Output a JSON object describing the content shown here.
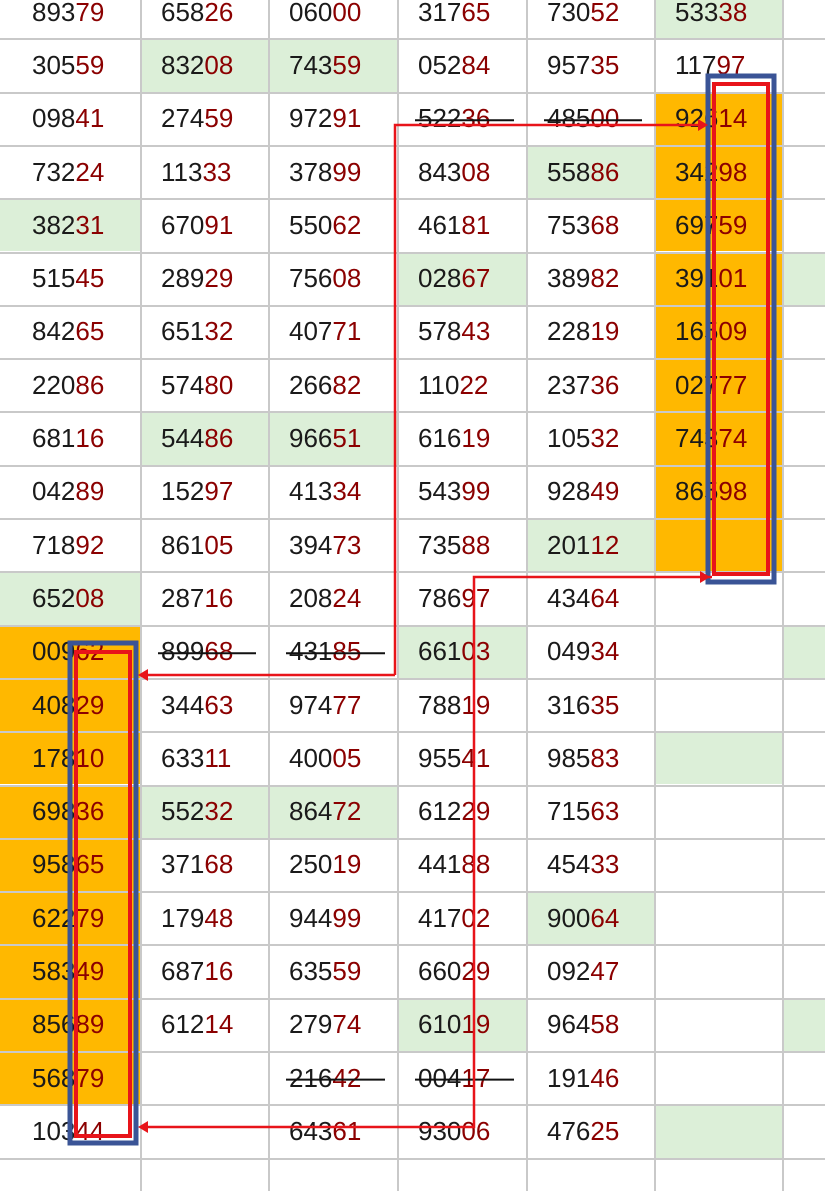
{
  "colors": {
    "highlight_green": "#dcefd8",
    "highlight_orange": "#ffb800",
    "digits_dark": "#1a1a1a",
    "digits_red": "#8b0000",
    "arrow_red": "#e8141a",
    "frame_blue": "#3a5496",
    "gridline": "#c9c9c9"
  },
  "rows": [
    [
      "89379",
      "65826",
      "06000",
      "31765",
      "73052",
      "53338",
      ""
    ],
    [
      "30559",
      "83208",
      "74359",
      "05284",
      "95735",
      "11797",
      ""
    ],
    [
      "09841",
      "27459",
      "97291",
      "52236",
      "48500",
      "92614",
      ""
    ],
    [
      "73224",
      "11333",
      "37899",
      "84308",
      "55886",
      "34298",
      ""
    ],
    [
      "38231",
      "67091",
      "55062",
      "46181",
      "75368",
      "69759",
      ""
    ],
    [
      "51545",
      "28929",
      "75608",
      "02867",
      "38982",
      "39101",
      ""
    ],
    [
      "84265",
      "65132",
      "40771",
      "57843",
      "22819",
      "16509",
      ""
    ],
    [
      "22086",
      "57480",
      "26682",
      "11022",
      "23736",
      "02777",
      ""
    ],
    [
      "68116",
      "54486",
      "96651",
      "61619",
      "10532",
      "74374",
      ""
    ],
    [
      "04289",
      "15297",
      "41334",
      "54399",
      "92849",
      "86598",
      ""
    ],
    [
      "71892",
      "86105",
      "39473",
      "73588",
      "20112",
      "",
      ""
    ],
    [
      "65208",
      "28716",
      "20824",
      "78697",
      "43464",
      "",
      ""
    ],
    [
      "00962",
      "89968",
      "43185",
      "66103",
      "04934",
      "",
      ""
    ],
    [
      "40829",
      "34463",
      "97477",
      "78819",
      "31635",
      "",
      ""
    ],
    [
      "17810",
      "63311",
      "40005",
      "95541",
      "98583",
      "",
      ""
    ],
    [
      "69836",
      "55232",
      "86472",
      "61229",
      "71563",
      "",
      ""
    ],
    [
      "95865",
      "37168",
      "25019",
      "44188",
      "45433",
      "",
      ""
    ],
    [
      "62279",
      "17948",
      "94499",
      "41702",
      "90064",
      "",
      ""
    ],
    [
      "58349",
      "68716",
      "63559",
      "66029",
      "09247",
      "",
      ""
    ],
    [
      "85689",
      "61214",
      "27974",
      "61019",
      "96458",
      "",
      ""
    ],
    [
      "56879",
      "",
      "21642",
      "00417",
      "19146",
      "",
      ""
    ],
    [
      "10344",
      "",
      "64361",
      "93006",
      "47625",
      "",
      ""
    ]
  ],
  "fills": [
    [
      "",
      "",
      "",
      "",
      "",
      "green",
      ""
    ],
    [
      "",
      "green",
      "green",
      "",
      "",
      "",
      ""
    ],
    [
      "",
      "",
      "",
      "",
      "",
      "orange",
      ""
    ],
    [
      "",
      "",
      "",
      "",
      "green",
      "orange",
      ""
    ],
    [
      "green",
      "",
      "",
      "",
      "",
      "orange",
      ""
    ],
    [
      "",
      "",
      "",
      "green",
      "",
      "orange",
      "green"
    ],
    [
      "",
      "",
      "",
      "",
      "",
      "orange",
      ""
    ],
    [
      "",
      "",
      "",
      "",
      "",
      "orange",
      ""
    ],
    [
      "",
      "green",
      "green",
      "",
      "",
      "orange",
      ""
    ],
    [
      "",
      "",
      "",
      "",
      "",
      "orange",
      ""
    ],
    [
      "",
      "",
      "",
      "",
      "green",
      "orange",
      ""
    ],
    [
      "green",
      "",
      "",
      "",
      "",
      "",
      ""
    ],
    [
      "orange",
      "",
      "",
      "green",
      "",
      "",
      "green"
    ],
    [
      "orange",
      "",
      "",
      "",
      "",
      "",
      ""
    ],
    [
      "orange",
      "",
      "",
      "",
      "",
      "green",
      ""
    ],
    [
      "orange",
      "green",
      "green",
      "",
      "",
      "",
      ""
    ],
    [
      "orange",
      "",
      "",
      "",
      "",
      "",
      ""
    ],
    [
      "orange",
      "",
      "",
      "",
      "green",
      "",
      ""
    ],
    [
      "orange",
      "",
      "",
      "",
      "",
      "",
      ""
    ],
    [
      "orange",
      "",
      "",
      "green",
      "",
      "",
      "green"
    ],
    [
      "orange",
      "",
      "",
      "",
      "",
      "",
      ""
    ],
    [
      "",
      "",
      "",
      "",
      "",
      "green",
      ""
    ]
  ],
  "strike_cells": [
    [
      2,
      3
    ],
    [
      2,
      4
    ],
    [
      12,
      1
    ],
    [
      12,
      2
    ],
    [
      20,
      2
    ],
    [
      20,
      3
    ]
  ]
}
